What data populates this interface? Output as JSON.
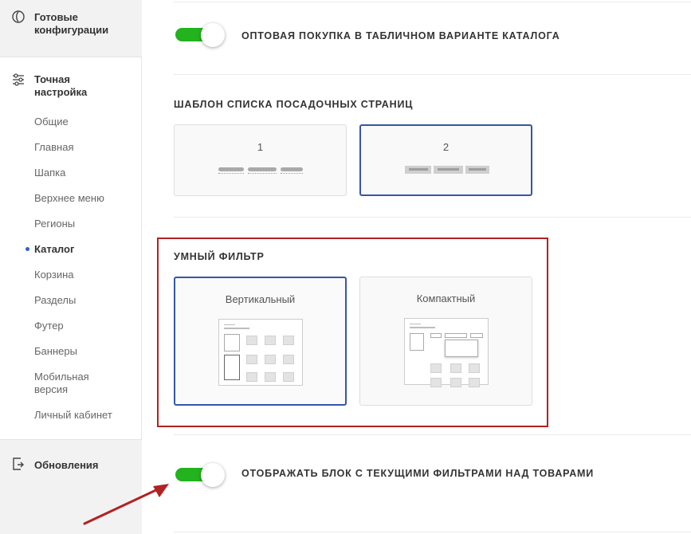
{
  "sidebar": {
    "ready_configs": "Готовые конфигурации",
    "fine_tuning": "Точная настройка",
    "items": [
      {
        "label": "Общие"
      },
      {
        "label": "Главная"
      },
      {
        "label": "Шапка"
      },
      {
        "label": "Верхнее меню"
      },
      {
        "label": "Регионы"
      },
      {
        "label": "Каталог",
        "active": true
      },
      {
        "label": "Корзина"
      },
      {
        "label": "Разделы"
      },
      {
        "label": "Футер"
      },
      {
        "label": "Баннеры"
      },
      {
        "label": "Мобильная версия"
      },
      {
        "label": "Личный кабинет"
      }
    ],
    "updates": "Обновления"
  },
  "main": {
    "option_wholesale": {
      "label": "Оптовая покупка в табличном варианте каталога",
      "enabled": true
    },
    "landing_template": {
      "title": "Шаблон списка посадочных страниц",
      "options": [
        {
          "label": "1",
          "selected": false
        },
        {
          "label": "2",
          "selected": true
        }
      ]
    },
    "smart_filter": {
      "title": "Умный фильтр",
      "options": [
        {
          "label": "Вертикальный",
          "selected": true
        },
        {
          "label": "Компактный",
          "selected": false
        }
      ]
    },
    "option_current_filters": {
      "label": "Отображать блок с текущими фильтрами над товарами",
      "enabled": true
    }
  },
  "colors": {
    "accent": "#3556a8",
    "toggle_on": "#22b31e",
    "highlight": "#b22222",
    "active_dot": "#2f5fd0"
  }
}
